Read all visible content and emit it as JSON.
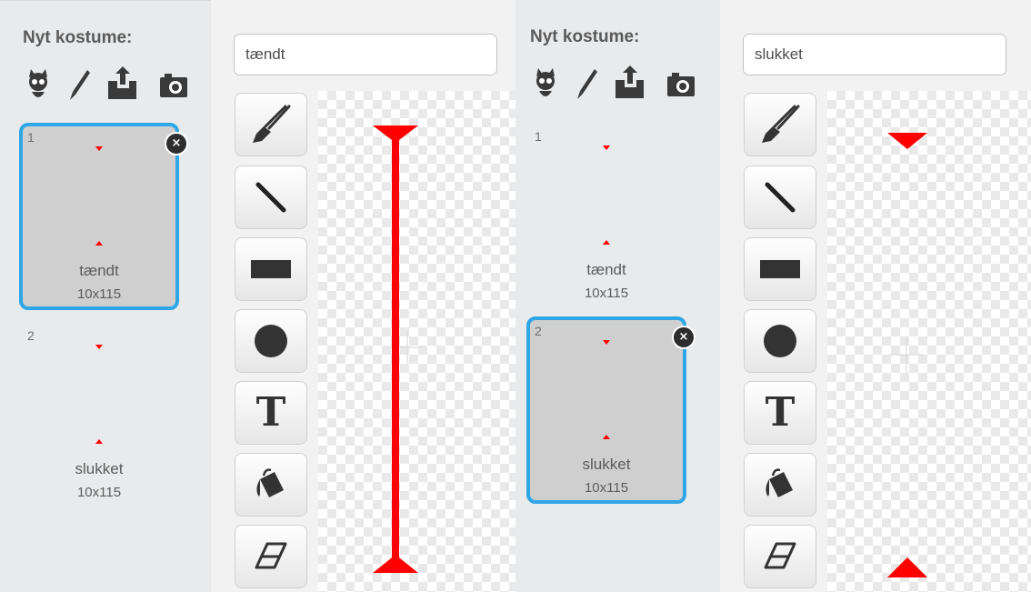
{
  "left": {
    "heading": "Nyt kostume:",
    "costume_name_value": "tændt",
    "costumes": [
      {
        "number": "1",
        "name": "tændt",
        "size": "10x115"
      },
      {
        "number": "2",
        "name": "slukket",
        "size": "10x115"
      }
    ],
    "delete_label": "×",
    "selected_costume": "1"
  },
  "right": {
    "heading": "Nyt kostume:",
    "costume_name_value": "slukket",
    "costumes": [
      {
        "number": "1",
        "name": "tændt",
        "size": "10x115"
      },
      {
        "number": "2",
        "name": "slukket",
        "size": "10x115"
      }
    ],
    "delete_label": "×",
    "selected_costume": "2"
  },
  "new_costume_icons": [
    "sprite-library-icon",
    "paint-brush-icon",
    "upload-icon",
    "camera-icon"
  ],
  "tools": [
    {
      "name": "brush-tool",
      "icon": "brush-icon"
    },
    {
      "name": "line-tool",
      "icon": "line-icon"
    },
    {
      "name": "rectangle-tool",
      "icon": "rectangle-icon"
    },
    {
      "name": "ellipse-tool",
      "icon": "ellipse-icon"
    },
    {
      "name": "text-tool",
      "icon": "text-icon",
      "label": "T"
    },
    {
      "name": "fill-tool",
      "icon": "paint-bucket-icon"
    },
    {
      "name": "eraser-tool",
      "icon": "eraser-icon"
    }
  ],
  "colors": {
    "selection_border": "#2fa6e6",
    "marker_red": "#ff0000",
    "panel_bg": "#e9eaeb",
    "editor_bg": "#f2f2f2"
  }
}
